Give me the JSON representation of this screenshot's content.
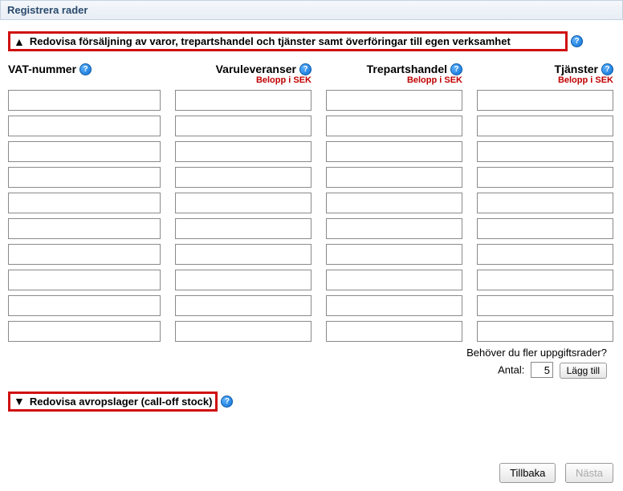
{
  "panel": {
    "title": "Registrera rader"
  },
  "section1": {
    "label": "Redovisa försäljning av varor, trepartshandel och tjänster samt överföringar till egen verksamhet"
  },
  "columns": {
    "vat": {
      "label": "VAT-nummer"
    },
    "varu": {
      "label": "Varuleveranser",
      "sub": "Belopp i SEK"
    },
    "treparts": {
      "label": "Trepartshandel",
      "sub": "Belopp i SEK"
    },
    "tjanster": {
      "label": "Tjänster",
      "sub": "Belopp i SEK"
    }
  },
  "rows": [
    {
      "vat": "",
      "varu": "",
      "treparts": "",
      "tjanster": ""
    },
    {
      "vat": "",
      "varu": "",
      "treparts": "",
      "tjanster": ""
    },
    {
      "vat": "",
      "varu": "",
      "treparts": "",
      "tjanster": ""
    },
    {
      "vat": "",
      "varu": "",
      "treparts": "",
      "tjanster": ""
    },
    {
      "vat": "",
      "varu": "",
      "treparts": "",
      "tjanster": ""
    },
    {
      "vat": "",
      "varu": "",
      "treparts": "",
      "tjanster": ""
    },
    {
      "vat": "",
      "varu": "",
      "treparts": "",
      "tjanster": ""
    },
    {
      "vat": "",
      "varu": "",
      "treparts": "",
      "tjanster": ""
    },
    {
      "vat": "",
      "varu": "",
      "treparts": "",
      "tjanster": ""
    },
    {
      "vat": "",
      "varu": "",
      "treparts": "",
      "tjanster": ""
    }
  ],
  "addRows": {
    "prompt": "Behöver du fler uppgiftsrader?",
    "antalLabel": "Antal:",
    "antalValue": "5",
    "buttonLabel": "Lägg till"
  },
  "section2": {
    "label": "Redovisa avropslager (call-off stock)"
  },
  "footer": {
    "back": "Tillbaka",
    "next": "Nästa"
  }
}
